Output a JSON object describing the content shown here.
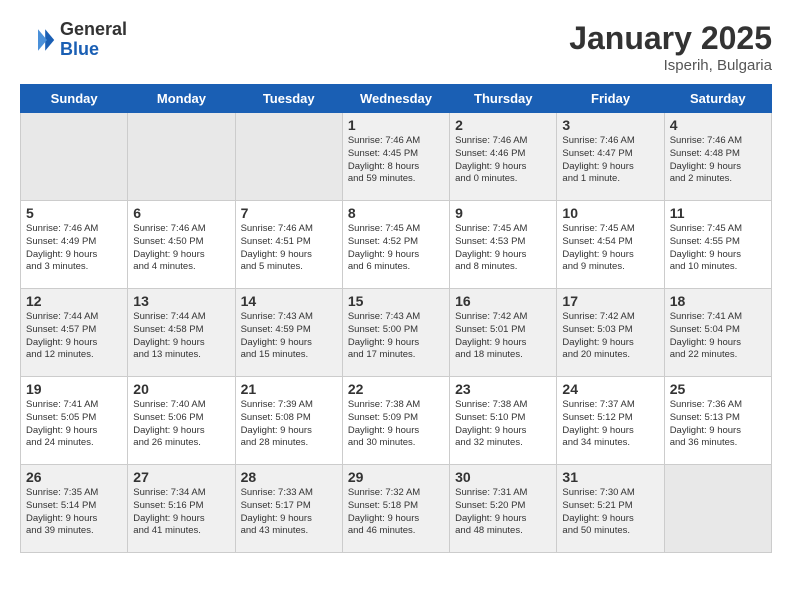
{
  "logo": {
    "general": "General",
    "blue": "Blue"
  },
  "title": "January 2025",
  "subtitle": "Isperih, Bulgaria",
  "headers": [
    "Sunday",
    "Monday",
    "Tuesday",
    "Wednesday",
    "Thursday",
    "Friday",
    "Saturday"
  ],
  "weeks": [
    [
      {
        "day": "",
        "text": ""
      },
      {
        "day": "",
        "text": ""
      },
      {
        "day": "",
        "text": ""
      },
      {
        "day": "1",
        "text": "Sunrise: 7:46 AM\nSunset: 4:45 PM\nDaylight: 8 hours\nand 59 minutes."
      },
      {
        "day": "2",
        "text": "Sunrise: 7:46 AM\nSunset: 4:46 PM\nDaylight: 9 hours\nand 0 minutes."
      },
      {
        "day": "3",
        "text": "Sunrise: 7:46 AM\nSunset: 4:47 PM\nDaylight: 9 hours\nand 1 minute."
      },
      {
        "day": "4",
        "text": "Sunrise: 7:46 AM\nSunset: 4:48 PM\nDaylight: 9 hours\nand 2 minutes."
      }
    ],
    [
      {
        "day": "5",
        "text": "Sunrise: 7:46 AM\nSunset: 4:49 PM\nDaylight: 9 hours\nand 3 minutes."
      },
      {
        "day": "6",
        "text": "Sunrise: 7:46 AM\nSunset: 4:50 PM\nDaylight: 9 hours\nand 4 minutes."
      },
      {
        "day": "7",
        "text": "Sunrise: 7:46 AM\nSunset: 4:51 PM\nDaylight: 9 hours\nand 5 minutes."
      },
      {
        "day": "8",
        "text": "Sunrise: 7:45 AM\nSunset: 4:52 PM\nDaylight: 9 hours\nand 6 minutes."
      },
      {
        "day": "9",
        "text": "Sunrise: 7:45 AM\nSunset: 4:53 PM\nDaylight: 9 hours\nand 8 minutes."
      },
      {
        "day": "10",
        "text": "Sunrise: 7:45 AM\nSunset: 4:54 PM\nDaylight: 9 hours\nand 9 minutes."
      },
      {
        "day": "11",
        "text": "Sunrise: 7:45 AM\nSunset: 4:55 PM\nDaylight: 9 hours\nand 10 minutes."
      }
    ],
    [
      {
        "day": "12",
        "text": "Sunrise: 7:44 AM\nSunset: 4:57 PM\nDaylight: 9 hours\nand 12 minutes."
      },
      {
        "day": "13",
        "text": "Sunrise: 7:44 AM\nSunset: 4:58 PM\nDaylight: 9 hours\nand 13 minutes."
      },
      {
        "day": "14",
        "text": "Sunrise: 7:43 AM\nSunset: 4:59 PM\nDaylight: 9 hours\nand 15 minutes."
      },
      {
        "day": "15",
        "text": "Sunrise: 7:43 AM\nSunset: 5:00 PM\nDaylight: 9 hours\nand 17 minutes."
      },
      {
        "day": "16",
        "text": "Sunrise: 7:42 AM\nSunset: 5:01 PM\nDaylight: 9 hours\nand 18 minutes."
      },
      {
        "day": "17",
        "text": "Sunrise: 7:42 AM\nSunset: 5:03 PM\nDaylight: 9 hours\nand 20 minutes."
      },
      {
        "day": "18",
        "text": "Sunrise: 7:41 AM\nSunset: 5:04 PM\nDaylight: 9 hours\nand 22 minutes."
      }
    ],
    [
      {
        "day": "19",
        "text": "Sunrise: 7:41 AM\nSunset: 5:05 PM\nDaylight: 9 hours\nand 24 minutes."
      },
      {
        "day": "20",
        "text": "Sunrise: 7:40 AM\nSunset: 5:06 PM\nDaylight: 9 hours\nand 26 minutes."
      },
      {
        "day": "21",
        "text": "Sunrise: 7:39 AM\nSunset: 5:08 PM\nDaylight: 9 hours\nand 28 minutes."
      },
      {
        "day": "22",
        "text": "Sunrise: 7:38 AM\nSunset: 5:09 PM\nDaylight: 9 hours\nand 30 minutes."
      },
      {
        "day": "23",
        "text": "Sunrise: 7:38 AM\nSunset: 5:10 PM\nDaylight: 9 hours\nand 32 minutes."
      },
      {
        "day": "24",
        "text": "Sunrise: 7:37 AM\nSunset: 5:12 PM\nDaylight: 9 hours\nand 34 minutes."
      },
      {
        "day": "25",
        "text": "Sunrise: 7:36 AM\nSunset: 5:13 PM\nDaylight: 9 hours\nand 36 minutes."
      }
    ],
    [
      {
        "day": "26",
        "text": "Sunrise: 7:35 AM\nSunset: 5:14 PM\nDaylight: 9 hours\nand 39 minutes."
      },
      {
        "day": "27",
        "text": "Sunrise: 7:34 AM\nSunset: 5:16 PM\nDaylight: 9 hours\nand 41 minutes."
      },
      {
        "day": "28",
        "text": "Sunrise: 7:33 AM\nSunset: 5:17 PM\nDaylight: 9 hours\nand 43 minutes."
      },
      {
        "day": "29",
        "text": "Sunrise: 7:32 AM\nSunset: 5:18 PM\nDaylight: 9 hours\nand 46 minutes."
      },
      {
        "day": "30",
        "text": "Sunrise: 7:31 AM\nSunset: 5:20 PM\nDaylight: 9 hours\nand 48 minutes."
      },
      {
        "day": "31",
        "text": "Sunrise: 7:30 AM\nSunset: 5:21 PM\nDaylight: 9 hours\nand 50 minutes."
      },
      {
        "day": "",
        "text": ""
      }
    ]
  ]
}
